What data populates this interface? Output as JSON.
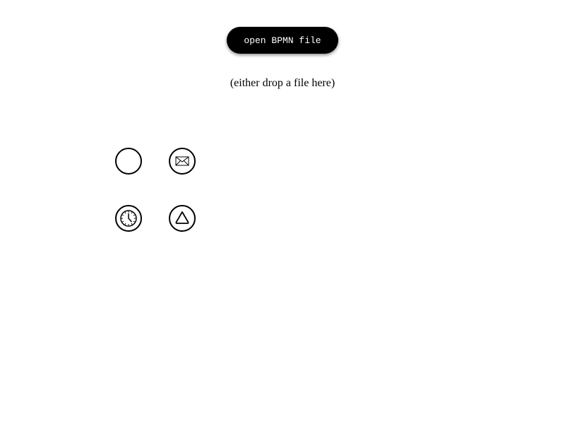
{
  "toolbar": {
    "open_button_label": "open BPMN file"
  },
  "drop_zone": {
    "hint": "(either drop a file here)"
  },
  "palette": {
    "items": [
      {
        "icon": "start-event-icon"
      },
      {
        "icon": "message-event-icon"
      },
      {
        "icon": "timer-event-icon"
      },
      {
        "icon": "signal-event-icon"
      }
    ]
  }
}
